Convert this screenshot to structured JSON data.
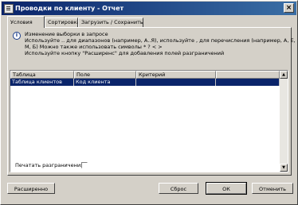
{
  "window": {
    "title": "Проводки по клиенту - Отчет",
    "close_glyph": "×"
  },
  "tabs": [
    {
      "label": "Условия",
      "active": true
    },
    {
      "label": "Сортировка",
      "active": false
    },
    {
      "label": "Загрузить / Сохранить",
      "active": false
    }
  ],
  "info": {
    "icon": "info-icon",
    "lines": [
      "Изменение выборки в запросе",
      "Используйте .. для диапазонов (например, А..Я), используйте , для перечисления (например, А, Е,",
      "М, Б) Можно также использовать символы * ? < >",
      "Используйте кнопку \"Расширенс\" для добавления полей разграничений"
    ]
  },
  "grid": {
    "columns": [
      "Таблица",
      "Поле",
      "Критерий",
      ""
    ],
    "rows": [
      {
        "cells": [
          "Таблица клиентов",
          "Код клиента",
          "",
          ""
        ],
        "selected": true
      }
    ],
    "scroll_up": "▲",
    "scroll_down": "▼"
  },
  "checkbox": {
    "label": "Печатать разграничения",
    "checked": false
  },
  "buttons": {
    "advanced": "Расширенно",
    "reset": "Сброс",
    "ok": "ОК",
    "cancel": "Отменить"
  },
  "colors": {
    "title_bar": "#0a246a",
    "selection": "#0a246a",
    "face": "#d4d0c8"
  }
}
